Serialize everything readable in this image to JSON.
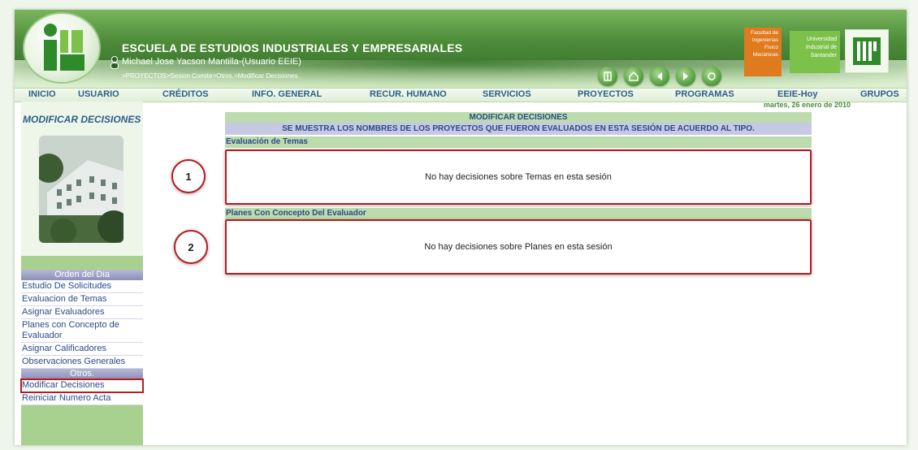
{
  "header": {
    "institution": "ESCUELA DE ESTUDIOS INDUSTRIALES Y EMPRESARIALES",
    "user": "Michael Jose Yacson Mantilla-(Usuario EEIE)",
    "breadcrumb": ">PROYECTOS>Sesion Comite>Otros.>Modificar Decisiones.",
    "logo_faculty": "Facultad de Ingenierías Fisico Mecánicas",
    "logo_university": "Universidad Industrial de Santander",
    "nav_icons": [
      "exit-icon",
      "home-icon",
      "back-icon",
      "forward-icon",
      "refresh-icon"
    ]
  },
  "menu": {
    "items": [
      "INICIO",
      "USUARIO",
      "CRÉDITOS",
      "INFO. GENERAL",
      "RECUR. HUMANO",
      "SERVICIOS",
      "PROYECTOS",
      "PROGRAMAS",
      "EEIE-Hoy",
      "GRUPOS"
    ]
  },
  "date": "martes, 26 enero de 2010",
  "sidebar": {
    "title": "MODIFICAR DECISIONES",
    "section_order": "Orden del Dia",
    "items": [
      "Estudio De Solicitudes",
      "Evaluacion de Temas",
      "Asignar Evaluadores",
      "Planes con Concepto de Evaluador",
      "Asignar Calificadores",
      "Observaciones Generales"
    ],
    "section_other": "Otros.",
    "other_items": [
      "Modificar Decisiones",
      "Reiniciar Numero Acta"
    ]
  },
  "main": {
    "title": "MODIFICAR DECISIONES",
    "subtitle": "SE MUESTRA LOS NOMBRES DE LOS PROYECTOS QUE FUERON EVALUADOS EN ESTA SESIÓN DE ACUERDO AL TIPO.",
    "section1_label": "Evaluación de Temas",
    "section1_empty": "No hay decisiones sobre Temas en esta sesión",
    "section2_label": "Planes Con Concepto Del Evaluador",
    "section2_empty": "No hay decisiones sobre Planes en esta sesión",
    "callout1": "1",
    "callout2": "2"
  },
  "colors": {
    "header_green": "#4e8c3a",
    "link_blue": "#2b5e8a",
    "highlight_red": "#b71c1c",
    "section_green": "#bcdcae",
    "section_lavender": "#c7c9e2"
  }
}
